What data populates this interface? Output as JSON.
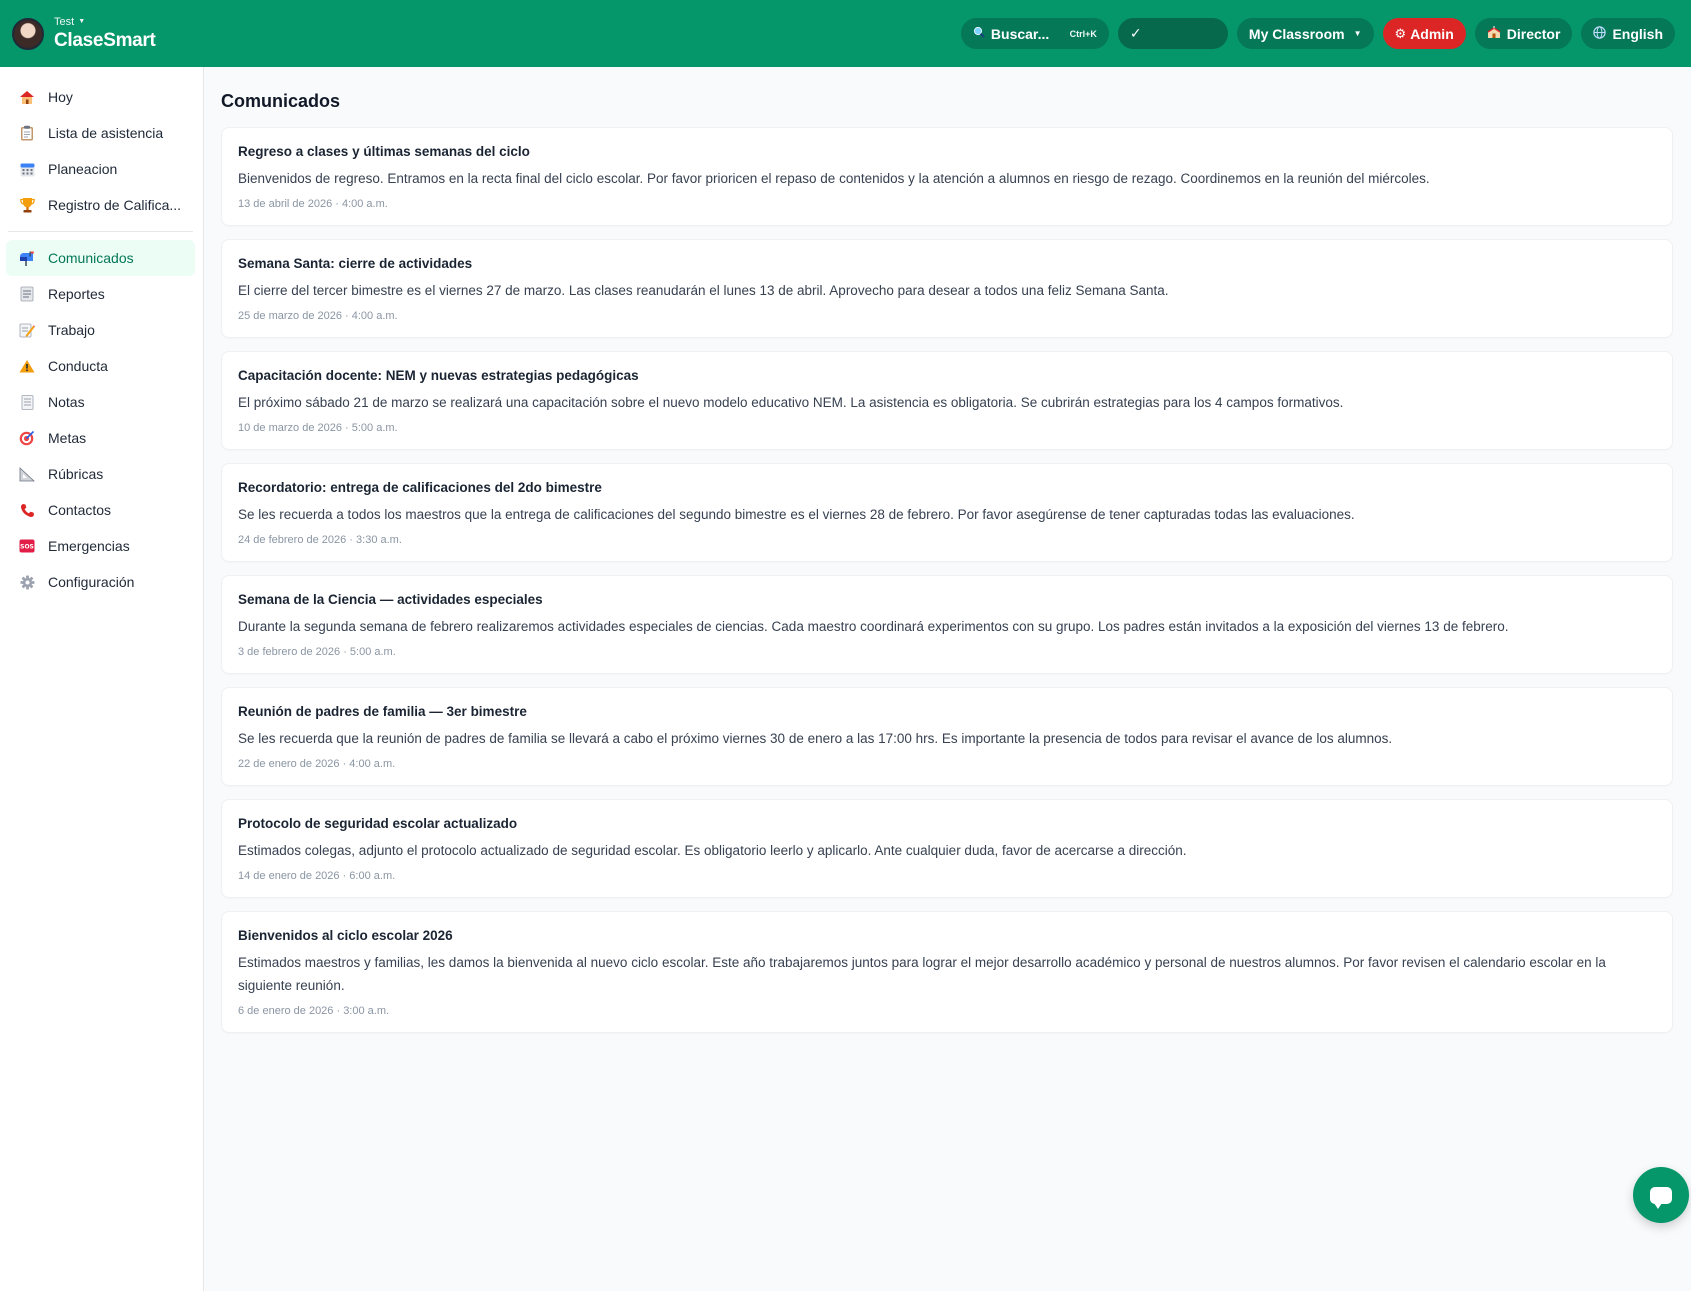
{
  "header": {
    "user_label": "Test",
    "app_name": "ClaseSmart",
    "search_label": "Buscar...",
    "search_shortcut": "Ctrl+K",
    "check_label": "✓",
    "classroom_label": "My Classroom",
    "admin_label": "Admin",
    "director_label": "Director",
    "language_label": "English"
  },
  "sidebar": {
    "group1": [
      {
        "label": "Hoy",
        "icon": "house-icon"
      },
      {
        "label": "Lista de asistencia",
        "icon": "clipboard-icon"
      },
      {
        "label": "Planeacion",
        "icon": "calendar-icon"
      },
      {
        "label": "Registro de Califica...",
        "icon": "trophy-icon"
      }
    ],
    "group2": [
      {
        "label": "Comunicados",
        "icon": "mailbox-icon",
        "active": true
      },
      {
        "label": "Reportes",
        "icon": "report-icon"
      },
      {
        "label": "Trabajo",
        "icon": "memo-icon"
      },
      {
        "label": "Conducta",
        "icon": "warning-icon"
      },
      {
        "label": "Notas",
        "icon": "notepad-icon"
      },
      {
        "label": "Metas",
        "icon": "target-icon"
      },
      {
        "label": "Rúbricas",
        "icon": "ruler-icon"
      },
      {
        "label": "Contactos",
        "icon": "phone-icon"
      },
      {
        "label": "Emergencias",
        "icon": "sos-icon"
      },
      {
        "label": "Configuración",
        "icon": "gear-icon"
      }
    ]
  },
  "main": {
    "title": "Comunicados",
    "announcements": [
      {
        "title": "Regreso a clases y últimas semanas del ciclo",
        "body": "Bienvenidos de regreso. Entramos en la recta final del ciclo escolar. Por favor prioricen el repaso de contenidos y la atención a alumnos en riesgo de rezago. Coordinemos en la reunión del miércoles.",
        "date": "13 de abril de 2026 · 4:00 a.m."
      },
      {
        "title": "Semana Santa: cierre de actividades",
        "body": "El cierre del tercer bimestre es el viernes 27 de marzo. Las clases reanudarán el lunes 13 de abril. Aprovecho para desear a todos una feliz Semana Santa.",
        "date": "25 de marzo de 2026 · 4:00 a.m."
      },
      {
        "title": "Capacitación docente: NEM y nuevas estrategias pedagógicas",
        "body": "El próximo sábado 21 de marzo se realizará una capacitación sobre el nuevo modelo educativo NEM. La asistencia es obligatoria. Se cubrirán estrategias para los 4 campos formativos.",
        "date": "10 de marzo de 2026 · 5:00 a.m."
      },
      {
        "title": "Recordatorio: entrega de calificaciones del 2do bimestre",
        "body": "Se les recuerda a todos los maestros que la entrega de calificaciones del segundo bimestre es el viernes 28 de febrero. Por favor asegúrense de tener capturadas todas las evaluaciones.",
        "date": "24 de febrero de 2026 · 3:30 a.m."
      },
      {
        "title": "Semana de la Ciencia — actividades especiales",
        "body": "Durante la segunda semana de febrero realizaremos actividades especiales de ciencias. Cada maestro coordinará experimentos con su grupo. Los padres están invitados a la exposición del viernes 13 de febrero.",
        "date": "3 de febrero de 2026 · 5:00 a.m."
      },
      {
        "title": "Reunión de padres de familia — 3er bimestre",
        "body": "Se les recuerda que la reunión de padres de familia se llevará a cabo el próximo viernes 30 de enero a las 17:00 hrs. Es importante la presencia de todos para revisar el avance de los alumnos.",
        "date": "22 de enero de 2026 · 4:00 a.m."
      },
      {
        "title": "Protocolo de seguridad escolar actualizado",
        "body": "Estimados colegas, adjunto el protocolo actualizado de seguridad escolar. Es obligatorio leerlo y aplicarlo. Ante cualquier duda, favor de acercarse a dirección.",
        "date": "14 de enero de 2026 · 6:00 a.m."
      },
      {
        "title": "Bienvenidos al ciclo escolar 2026",
        "body": "Estimados maestros y familias, les damos la bienvenida al nuevo ciclo escolar. Este año trabajaremos juntos para lograr el mejor desarrollo académico y personal de nuestros alumnos. Por favor revisen el calendario escolar en la siguiente reunión.",
        "date": "6 de enero de 2026 · 3:00 a.m."
      }
    ]
  },
  "colors": {
    "brand": "#059669",
    "brand_dark": "#047857",
    "admin": "#dc2626",
    "active_bg": "#ecfdf5"
  }
}
